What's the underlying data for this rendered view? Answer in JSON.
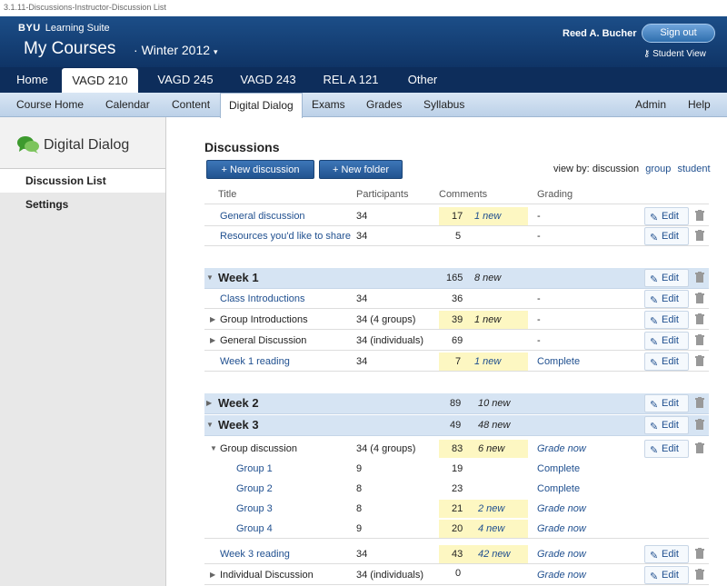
{
  "doc_title": "3.1.11-Discussions-Instructor-Discussion List",
  "header": {
    "brand": "BYU",
    "brand_sub": "Learning Suite",
    "courses_title": "My Courses",
    "term": "Winter 2012",
    "user": "Reed A. Bucher",
    "signout": "Sign out",
    "student_view": "Student View"
  },
  "tabs": [
    {
      "label": "Home"
    },
    {
      "label": "VAGD 210"
    },
    {
      "label": "VAGD 245"
    },
    {
      "label": "VAGD 243"
    },
    {
      "label": "REL A 121"
    },
    {
      "label": "Other"
    }
  ],
  "subnav": [
    "Course Home",
    "Calendar",
    "Content",
    "Digital Dialog",
    "Exams",
    "Grades",
    "Syllabus",
    "Admin",
    "Help"
  ],
  "sidebar": {
    "title": "Digital Dialog",
    "items": [
      "Discussion List",
      "Settings"
    ]
  },
  "main": {
    "heading": "Discussions",
    "new_discussion": "+ New discussion",
    "new_folder": "+ New folder",
    "view_by_label": "view by:",
    "view_by_current": "discussion",
    "view_by_group": "group",
    "view_by_student": "student",
    "columns": [
      "Title",
      "Participants",
      "Comments",
      "Grading"
    ],
    "edit_label": "Edit"
  },
  "rows": [
    {
      "title": "General discussion",
      "participants": "34",
      "comments": "17",
      "new": "1 new",
      "grading": "-"
    },
    {
      "title": "Resources you'd like to share",
      "participants": "34",
      "comments": "5",
      "new": "",
      "grading": "-"
    },
    {
      "week": "Week 1",
      "comments": "165",
      "new": "8 new"
    },
    {
      "title": "Class Introductions",
      "participants": "34",
      "comments": "36",
      "new": "",
      "grading": "-"
    },
    {
      "title": "Group Introductions",
      "participants": "34 (4 groups)",
      "comments": "39",
      "new": "1 new",
      "grading": "-"
    },
    {
      "title": "General Discussion",
      "participants": "34 (individuals)",
      "comments": "69",
      "new": "",
      "grading": "-"
    },
    {
      "title": "Week 1 reading",
      "participants": "34",
      "comments": "7",
      "new": "1 new",
      "grading": "Complete"
    },
    {
      "week": "Week 2",
      "comments": "89",
      "new": "10 new"
    },
    {
      "week": "Week 3",
      "comments": "49",
      "new": "48 new"
    },
    {
      "title": "Group discussion",
      "participants": "34 (4 groups)",
      "comments": "83",
      "new": "6 new",
      "grading": "Grade now"
    },
    {
      "title": "Group 1",
      "participants": "9",
      "comments": "19",
      "new": "",
      "grading": "Complete"
    },
    {
      "title": "Group 2",
      "participants": "8",
      "comments": "23",
      "new": "",
      "grading": "Complete"
    },
    {
      "title": "Group 3",
      "participants": "8",
      "comments": "21",
      "new": "2 new",
      "grading": "Grade now"
    },
    {
      "title": "Group 4",
      "participants": "9",
      "comments": "20",
      "new": "4 new",
      "grading": "Grade now"
    },
    {
      "title": "Week 3 reading",
      "participants": "34",
      "comments": "43",
      "new": "42 new",
      "grading": "Grade now"
    },
    {
      "title": "Individual Discussion",
      "participants": "34 (individuals)",
      "comments": "0",
      "new": "",
      "grading": "Grade now"
    }
  ]
}
